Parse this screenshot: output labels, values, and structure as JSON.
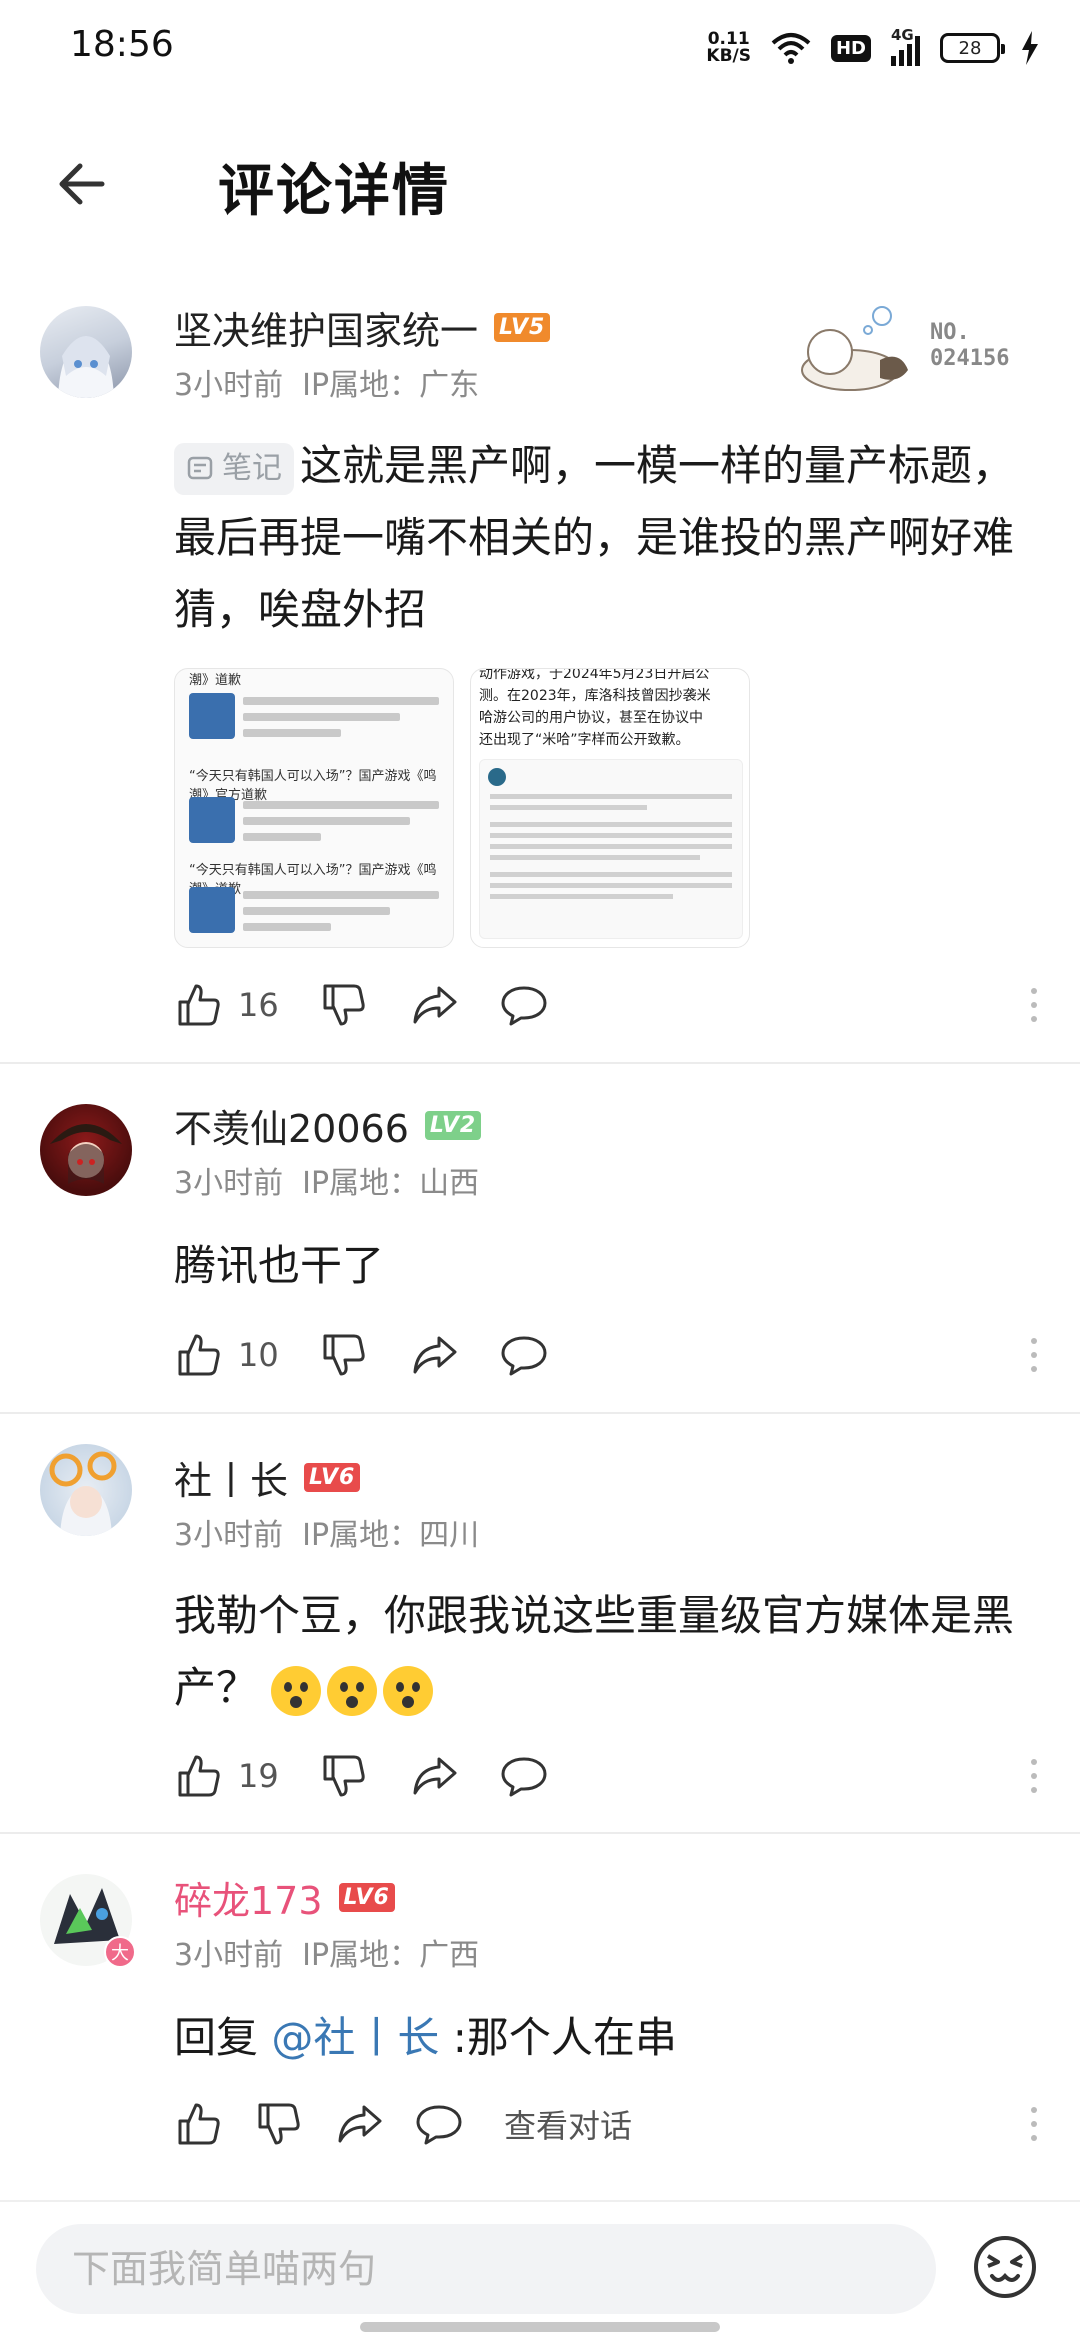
{
  "status_bar": {
    "time": "18:56",
    "net_speed_value": "0.11",
    "net_speed_unit": "KB/S",
    "hd": "HD",
    "signal": "4G",
    "battery": "28"
  },
  "header": {
    "title": "评论详情"
  },
  "comments": [
    {
      "username": "坚决维护国家统一",
      "level": "LV5",
      "level_color": "#f08a2c",
      "time": "3小时前",
      "ip_location": "IP属地：广东",
      "note_chip": "笔记",
      "text": "这就是黑产啊，一模一样的量产标题，最后再提一嘴不相关的，是谁投的黑产啊好难猜，唉盘外招",
      "likes": "16",
      "medal_no_label": "NO.",
      "medal_no_value": "024156",
      "images": {
        "left": {
          "items": [
            "潮》道歉",
            "“今天只有韩国人可以入场”？国产游戏《鸣潮》官方道歉",
            "“今天只有韩国人可以入场”？国产游戏《鸣潮》道歉"
          ]
        },
        "right": {
          "lines": [
            "动作游戏，于2024年5月23日开启公",
            "测。在2023年，库洛科技曾因抄袭米",
            "哈游公司的用户协议，甚至在协议中",
            "还出现了“米哈”字样而公开致歉。"
          ]
        }
      }
    },
    {
      "username": "不羡仙20066",
      "level": "LV2",
      "level_color": "#7ed08a",
      "time": "3小时前",
      "ip_location": "IP属地：山西",
      "text": "腾讯也干了",
      "likes": "10"
    },
    {
      "username": "社丨长",
      "level": "LV6",
      "level_color": "#e84b4b",
      "time": "3小时前",
      "ip_location": "IP属地：四川",
      "text": "我勒个豆，你跟我说这些重量级官方媒体是黑产？",
      "likes": "19"
    },
    {
      "username": "碎龙173",
      "level": "LV6",
      "level_color": "#e84b4b",
      "time": "3小时前",
      "ip_location": "IP属地：广西",
      "reply_prefix": "回复 ",
      "mention": "@社丨长",
      "text": " :那个人在串",
      "view_dialog": "查看对话",
      "avatar_badge": "大"
    }
  ],
  "input": {
    "placeholder": "下面我简单喵两句"
  }
}
